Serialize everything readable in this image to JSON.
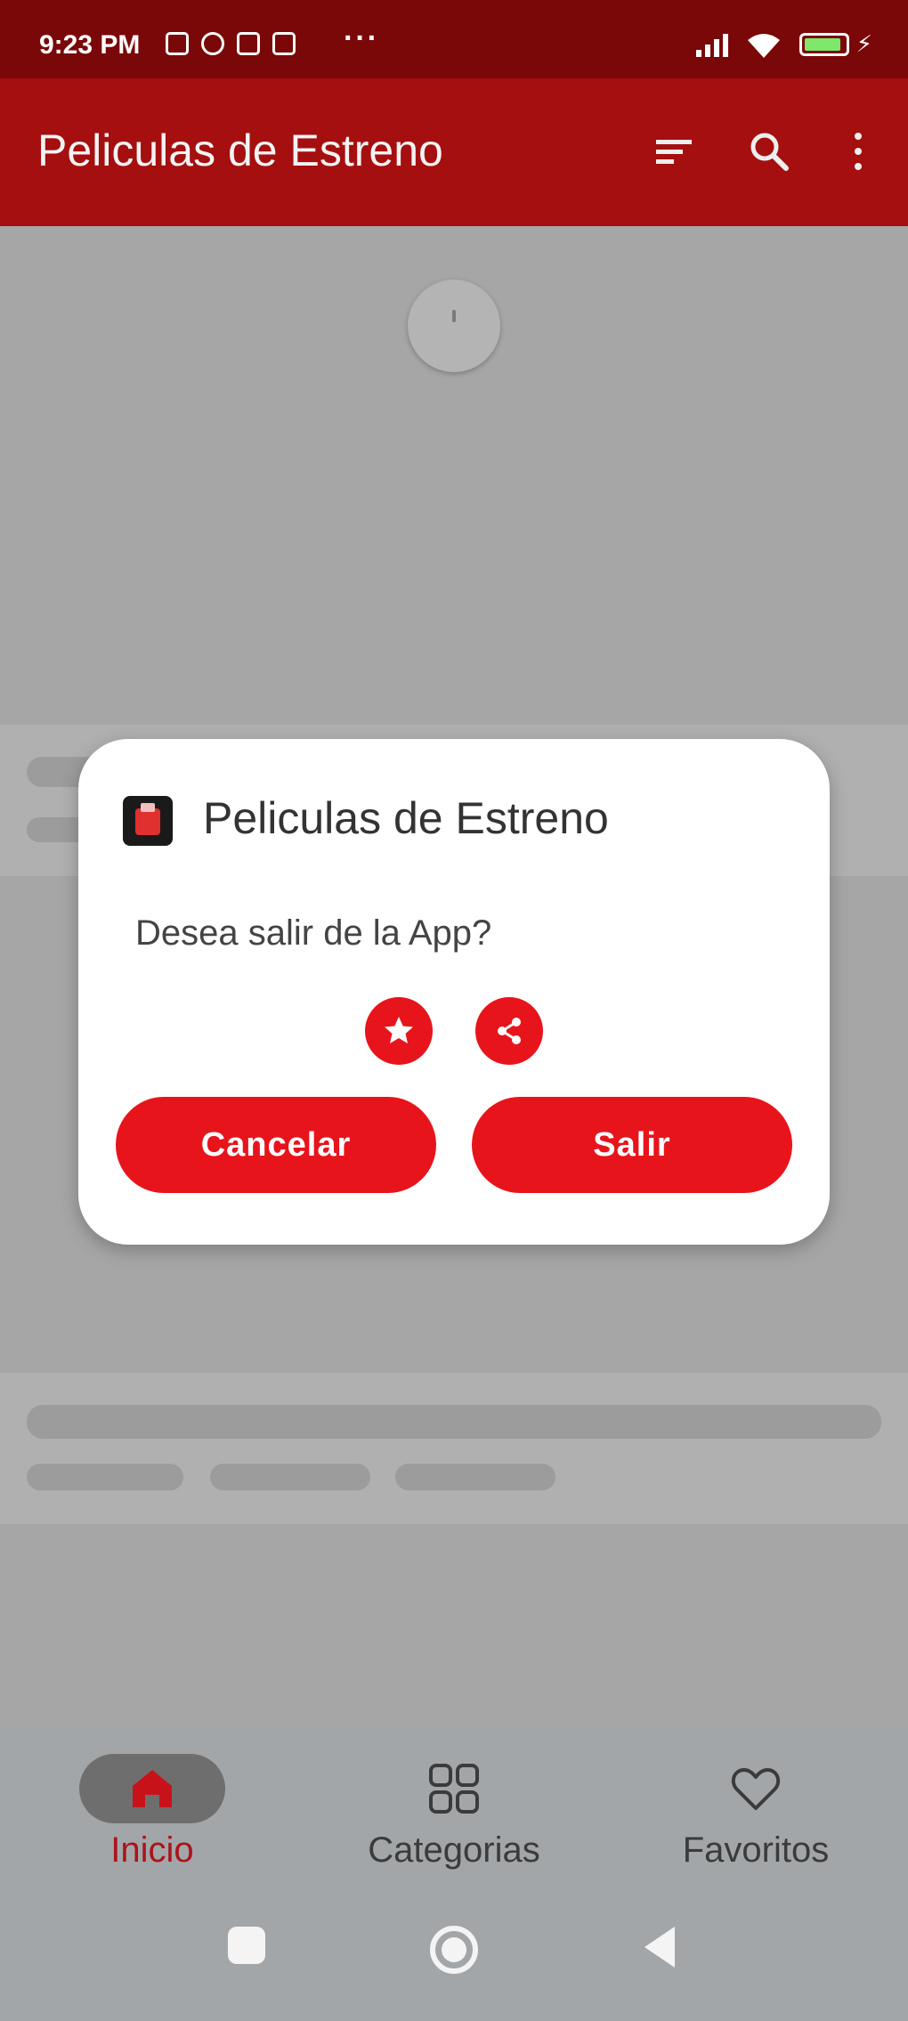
{
  "status_bar": {
    "time": "9:23 PM",
    "more_dots": "···"
  },
  "app_bar": {
    "title": "Peliculas de Estreno",
    "icons": [
      "sort-icon",
      "search-icon",
      "more-vert-icon"
    ]
  },
  "dialog": {
    "title": "Peliculas de Estreno",
    "message": "Desea salir de la App?",
    "icons": [
      "star-icon",
      "share-icon"
    ],
    "cancel_label": "Cancelar",
    "exit_label": "Salir"
  },
  "bottom_nav": {
    "items": [
      {
        "label": "Inicio",
        "icon": "home-icon",
        "active": true
      },
      {
        "label": "Categorias",
        "icon": "grid-icon",
        "active": false
      },
      {
        "label": "Favoritos",
        "icon": "heart-icon",
        "active": false
      }
    ]
  },
  "colors": {
    "app_bar": "#a50f0f",
    "status_bar": "#7a0808",
    "accent": "#e8141c",
    "active_nav_label": "#a8151a"
  }
}
